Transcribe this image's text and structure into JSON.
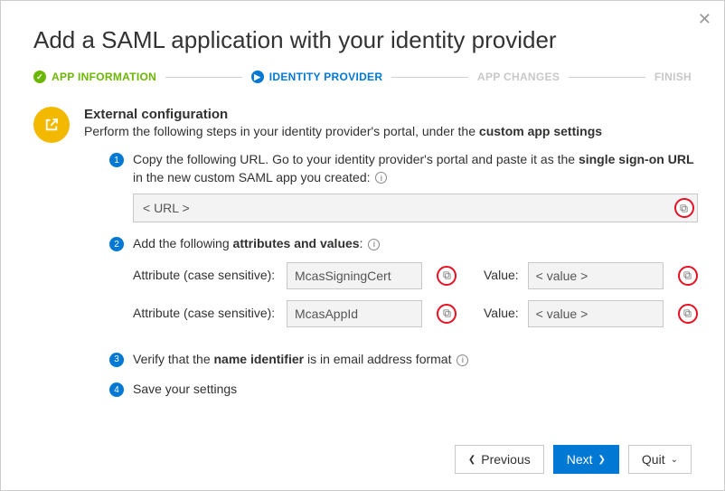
{
  "dialog": {
    "title": "Add a SAML application with your identity provider"
  },
  "stepper": {
    "step1": "APP INFORMATION",
    "step2": "IDENTITY PROVIDER",
    "step3": "APP CHANGES",
    "step4": "FINISH"
  },
  "section": {
    "title": "External configuration",
    "desc_pre": "Perform the following steps in your identity provider's portal, under the ",
    "desc_bold": "custom app settings"
  },
  "step1": {
    "text_pre": "Copy the following URL. Go to your identity provider's portal and paste it as the ",
    "text_bold": "single sign-on URL",
    "text_post": " in the new custom SAML app you created:",
    "url_value": "< URL >"
  },
  "step2": {
    "text_pre": "Add the following ",
    "text_bold": "attributes and values",
    "text_post": ":",
    "attr_label": "Attribute (case sensitive):",
    "val_label": "Value:",
    "rows": [
      {
        "attr": "McasSigningCert",
        "val": "< value >"
      },
      {
        "attr": "McasAppId",
        "val": "< value >"
      }
    ]
  },
  "step3": {
    "text_pre": "Verify that the ",
    "text_bold": "name identifier",
    "text_post": " is in email address format"
  },
  "step4": {
    "text": "Save your settings"
  },
  "footer": {
    "previous": "Previous",
    "next": "Next",
    "quit": "Quit"
  }
}
